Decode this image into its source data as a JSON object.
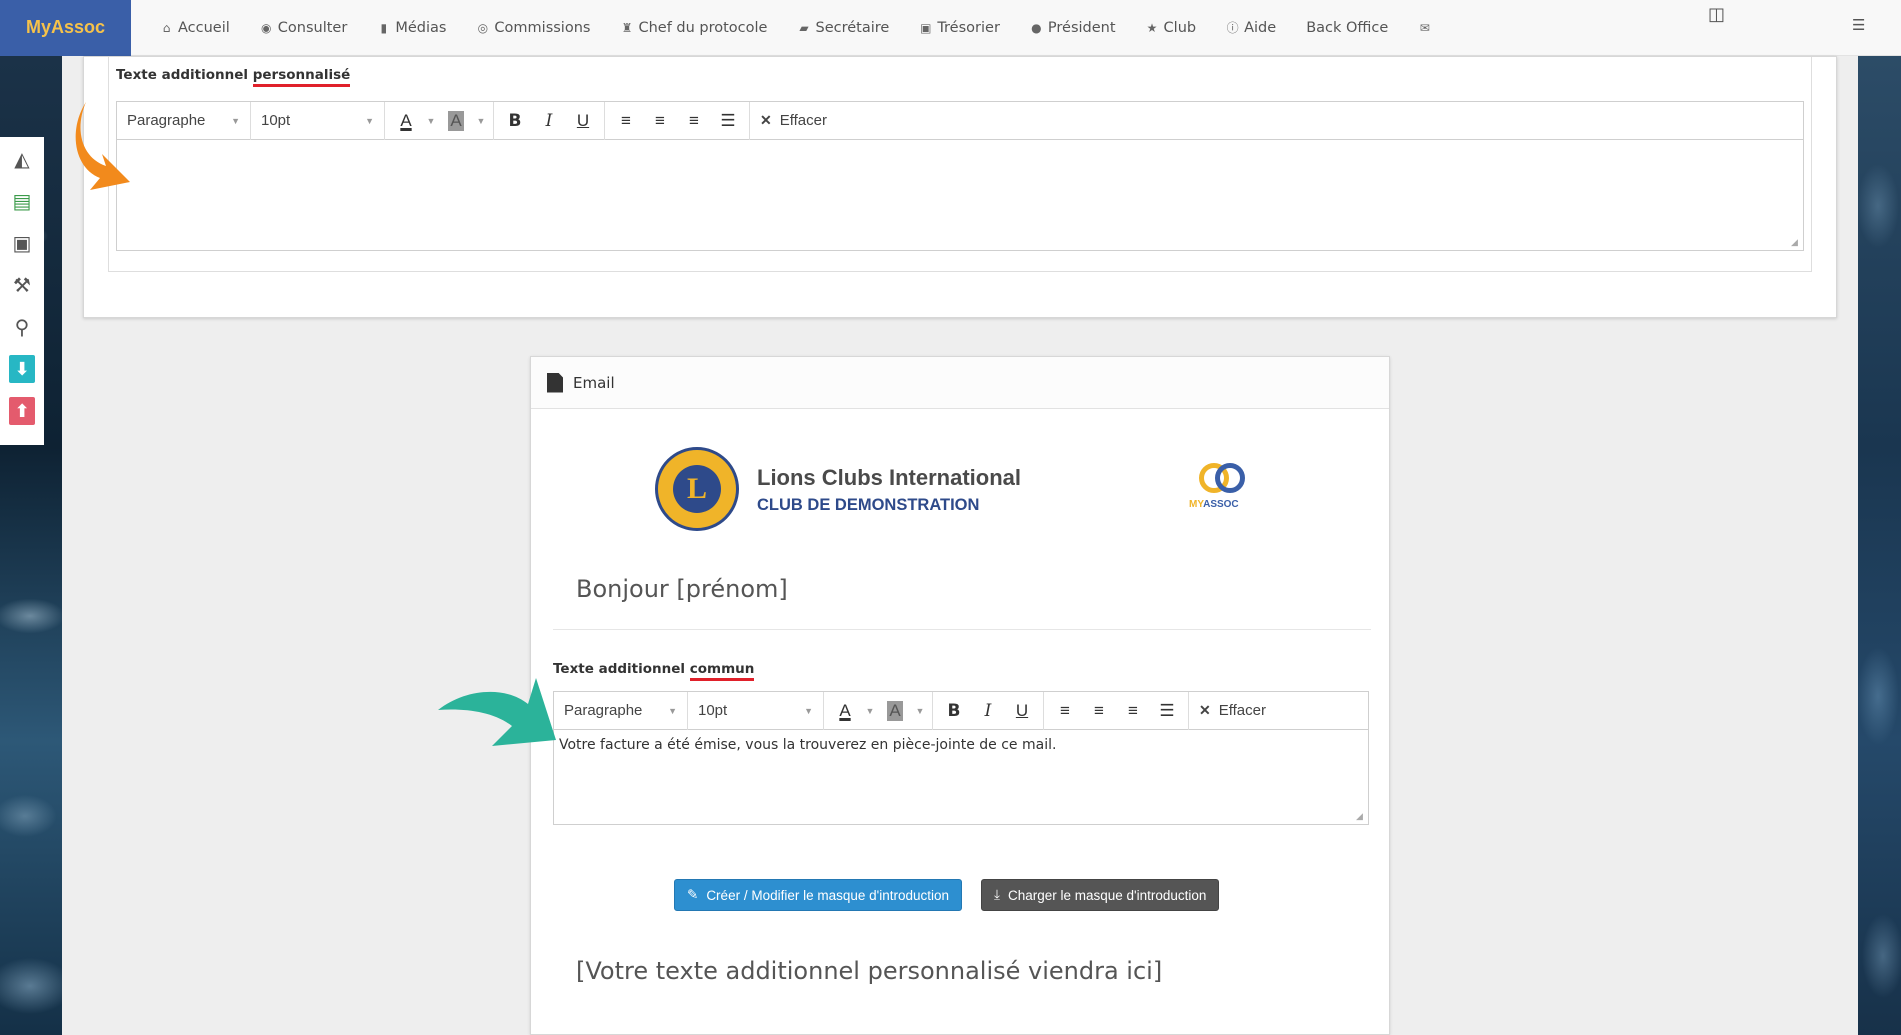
{
  "navbar": {
    "brand": "MyAssoc",
    "items": [
      {
        "icon": "home-icon",
        "glyph": "⌂",
        "label": "Accueil"
      },
      {
        "icon": "eye-icon",
        "glyph": "◉",
        "label": "Consulter"
      },
      {
        "icon": "file-icon",
        "glyph": "▮",
        "label": "Médias"
      },
      {
        "icon": "user-circle-icon",
        "glyph": "◎",
        "label": "Commissions"
      },
      {
        "icon": "trophy-icon",
        "glyph": "♜",
        "label": "Chef du protocole"
      },
      {
        "icon": "book-icon",
        "glyph": "▰",
        "label": "Secrétaire"
      },
      {
        "icon": "money-icon",
        "glyph": "▣",
        "label": "Trésorier"
      },
      {
        "icon": "globe-icon",
        "glyph": "●",
        "label": "Président"
      },
      {
        "icon": "star-icon",
        "glyph": "★",
        "label": "Club"
      },
      {
        "icon": "info-icon",
        "glyph": "ⓘ",
        "label": "Aide"
      },
      {
        "icon": "",
        "glyph": "",
        "label": "Back Office"
      },
      {
        "icon": "envelope-icon",
        "glyph": "✉",
        "label": ""
      }
    ]
  },
  "sidebar_tools": [
    {
      "icon": "area-chart-icon",
      "glyph": "◭"
    },
    {
      "icon": "document-icon",
      "glyph": "▤"
    },
    {
      "icon": "banknote-icon",
      "glyph": "▣"
    },
    {
      "icon": "wrench-icon",
      "glyph": "⚒"
    },
    {
      "icon": "map-marker-icon",
      "glyph": "⚲"
    },
    {
      "icon": "download-arrow-icon",
      "glyph": "⬇"
    },
    {
      "icon": "upload-arrow-icon",
      "glyph": "⬆"
    }
  ],
  "top_field": {
    "label_prefix": "Texte additionnel ",
    "label_emph": "personnalisé",
    "toolbar": {
      "paragraph": "Paragraphe",
      "size": "10pt",
      "clear": "Effacer"
    },
    "content": ""
  },
  "email_panel": {
    "title": "Email",
    "org_name": "Lions Clubs International",
    "club_name": "CLUB DE DEMONSTRATION",
    "myassoc_logo_a": "MY",
    "myassoc_logo_b": "ASSOC",
    "greeting": "Bonjour [prénom]",
    "common_field": {
      "label_prefix": "Texte additionnel ",
      "label_emph": "commun",
      "toolbar": {
        "paragraph": "Paragraphe",
        "size": "10pt",
        "clear": "Effacer"
      },
      "content": "Votre facture a été émise, vous la trouverez en pièce-jointe de ce mail."
    },
    "btn_edit_mask": "Créer / Modifier le masque d'introduction",
    "btn_load_mask": "Charger le masque d'introduction",
    "placeholder_custom": "[Votre texte additionnel personnalisé viendra ici]"
  },
  "colors": {
    "brand_bg": "#3a5fa8",
    "brand_text": "#f6c24a",
    "underline_red": "#e0202a",
    "arrow_orange": "#f28a1c",
    "arrow_teal": "#2bb39a",
    "btn_blue": "#2d8fd0",
    "btn_dark": "#555555"
  }
}
